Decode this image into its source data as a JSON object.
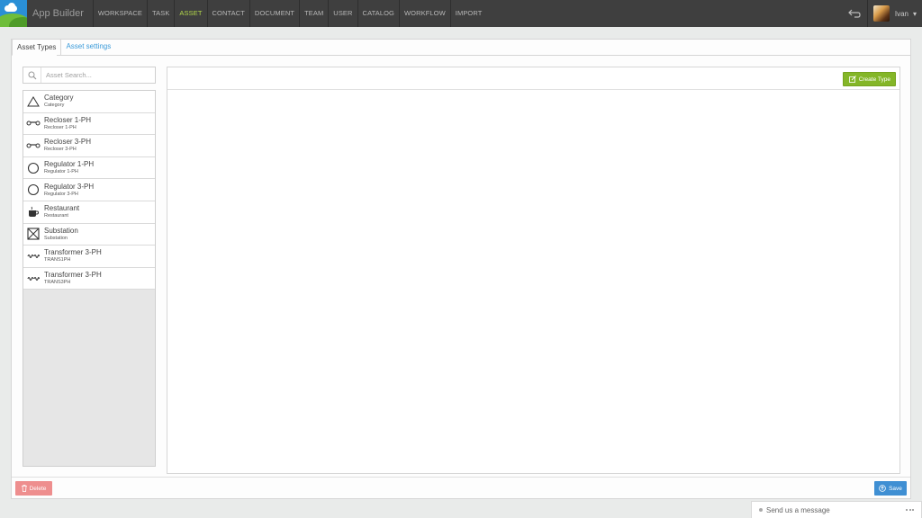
{
  "app": {
    "title": "App Builder"
  },
  "nav": {
    "items": [
      {
        "label": "WORKSPACE"
      },
      {
        "label": "TASK"
      },
      {
        "label": "ASSET"
      },
      {
        "label": "CONTACT"
      },
      {
        "label": "DOCUMENT"
      },
      {
        "label": "TEAM"
      },
      {
        "label": "USER"
      },
      {
        "label": "CATALOG"
      },
      {
        "label": "WORKFLOW"
      },
      {
        "label": "IMPORT"
      }
    ],
    "active": "ASSET",
    "active_color": "#b4d94b"
  },
  "user": {
    "name": "Ivan",
    "caret": "▾"
  },
  "tabs": [
    {
      "label": "Asset Types"
    },
    {
      "label": "Asset settings"
    }
  ],
  "search": {
    "placeholder": "Asset Search..."
  },
  "assets": [
    {
      "name": "Category",
      "sub": "Category",
      "icon": "triangle-icon"
    },
    {
      "name": "Recloser 1-PH",
      "sub": "Recloser 1-PH",
      "icon": "recloser-icon"
    },
    {
      "name": "Recloser 3-PH",
      "sub": "Recloser 3-PH",
      "icon": "recloser-icon"
    },
    {
      "name": "Regulator 1-PH",
      "sub": "Regulator 1-PH",
      "icon": "circle-icon"
    },
    {
      "name": "Regulator 3-PH",
      "sub": "Regulator 3-PH",
      "icon": "circle-icon"
    },
    {
      "name": "Restaurant",
      "sub": "Restaurant",
      "icon": "coffee-cup-icon"
    },
    {
      "name": "Substation",
      "sub": "Substation",
      "icon": "crossed-box-icon"
    },
    {
      "name": "Transformer 3-PH",
      "sub": "TRANS1PH",
      "icon": "transformer-icon"
    },
    {
      "name": "Transformer 3-PH",
      "sub": "TRANS3PH",
      "icon": "transformer-icon"
    }
  ],
  "buttons": {
    "create_type": "Create Type",
    "delete": "Delete",
    "save": "Save"
  },
  "colors": {
    "create": "#84b628",
    "delete": "#ee8e8e",
    "save": "#3f8fd3",
    "topbar": "#3f3f3f"
  },
  "chat": {
    "label": "Send us a message"
  }
}
